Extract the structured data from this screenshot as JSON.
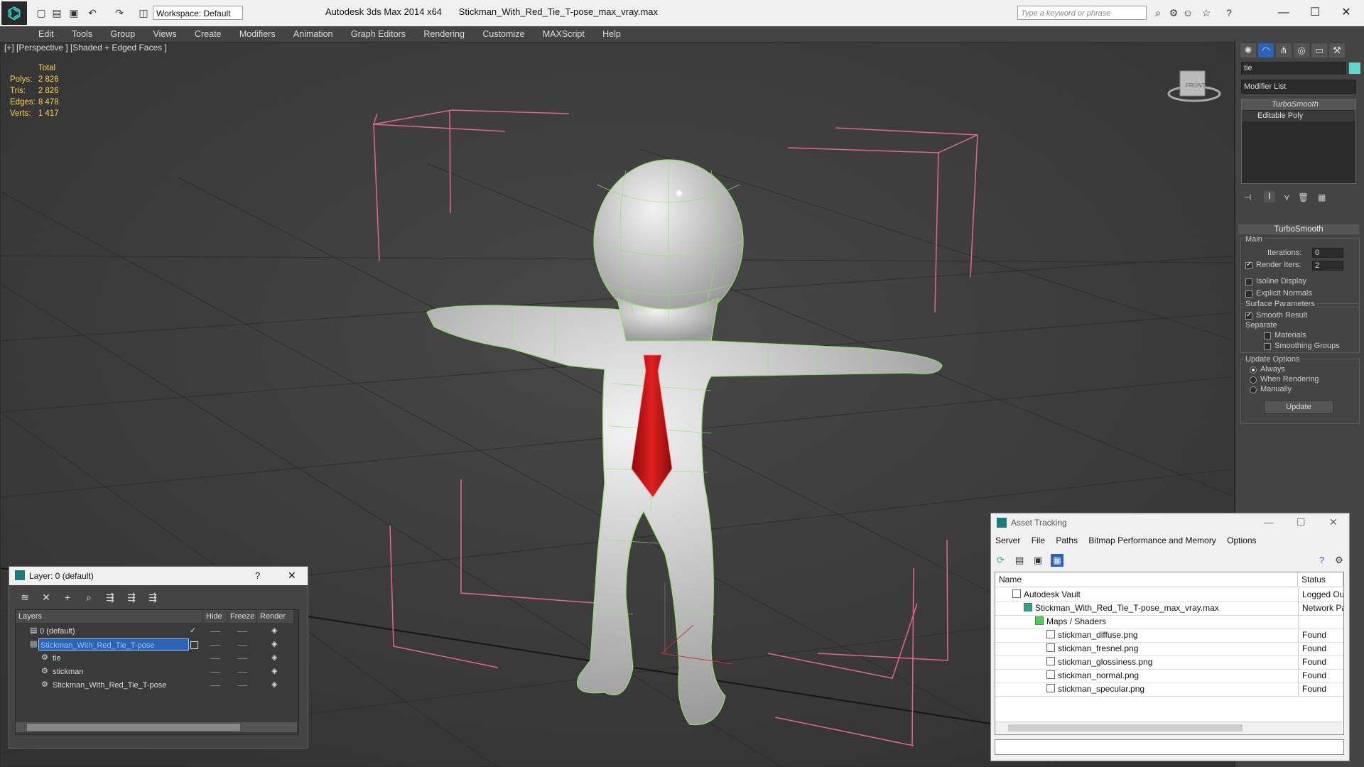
{
  "app": {
    "name": "Autodesk 3ds Max  2014 x64",
    "file": "Stickman_With_Red_Tie_T-pose_max_vray.max",
    "workspace": "Workspace: Default",
    "search_placeholder": "Type a keyword or phrase"
  },
  "menu": [
    "Edit",
    "Tools",
    "Group",
    "Views",
    "Create",
    "Modifiers",
    "Animation",
    "Graph Editors",
    "Rendering",
    "Customize",
    "MAXScript",
    "Help"
  ],
  "viewport": {
    "label": "[+] [Perspective ] [Shaded + Edged Faces ]",
    "stats": {
      "header": "Total",
      "rows": [
        {
          "label": "Polys:",
          "value": "2 826"
        },
        {
          "label": "Tris:",
          "value": "2 826"
        },
        {
          "label": "Edges:",
          "value": "8 478"
        },
        {
          "label": "Verts:",
          "value": "1 417"
        }
      ]
    },
    "cube_label": "FRONT"
  },
  "command_panel": {
    "object_name": "tie",
    "object_color": "#5ed8c8",
    "modifier_list": "Modifier List",
    "stack": [
      "TurboSmooth",
      "Editable Poly"
    ],
    "rollout_title": "TurboSmooth",
    "main_label": "Main",
    "iterations_label": "Iterations:",
    "iterations_value": "0",
    "render_iters_label": "Render Iters:",
    "render_iters_value": "2",
    "isoline": "Isoline Display",
    "explicit_normals": "Explicit Normals",
    "surface_params": "Surface Parameters",
    "smooth_result": "Smooth Result",
    "separate": "Separate",
    "materials": "Materials",
    "smoothing_groups": "Smoothing Groups",
    "update_options": "Update Options",
    "always": "Always",
    "when_rendering": "When Rendering",
    "manually": "Manually",
    "update_button": "Update"
  },
  "layer_dialog": {
    "title": "Layer: 0 (default)",
    "help": "?",
    "close": "✕",
    "columns": [
      "Layers",
      "Hide",
      "Freeze",
      "Render"
    ],
    "rows": [
      {
        "name": "0 (default)",
        "selected": false
      },
      {
        "name": "Stickman_With_Red_Tie_T-pose",
        "selected": true
      },
      {
        "name": "tie",
        "selected": false
      },
      {
        "name": "stickman",
        "selected": false
      },
      {
        "name": "Stickman_With_Red_Tie_T-pose",
        "selected": false
      }
    ]
  },
  "asset_dialog": {
    "title": "Asset Tracking",
    "menu": [
      "Server",
      "File",
      "Paths",
      "Bitmap Performance and Memory",
      "Options"
    ],
    "columns": [
      "Name",
      "Status"
    ],
    "rows": [
      {
        "name": "Autodesk Vault",
        "status": "Logged Out ..."
      },
      {
        "name": "Stickman_With_Red_Tie_T-pose_max_vray.max",
        "status": "Network Path"
      },
      {
        "name": "Maps / Shaders",
        "status": ""
      },
      {
        "name": "stickman_diffuse.png",
        "status": "Found"
      },
      {
        "name": "stickman_fresnel.png",
        "status": "Found"
      },
      {
        "name": "stickman_glossiness.png",
        "status": "Found"
      },
      {
        "name": "stickman_normal.png",
        "status": "Found"
      },
      {
        "name": "stickman_specular.png",
        "status": "Found"
      }
    ]
  }
}
